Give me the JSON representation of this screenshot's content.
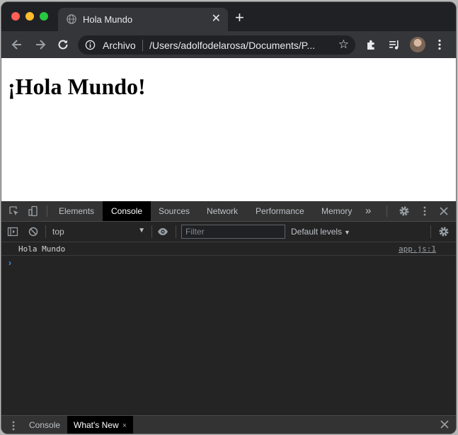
{
  "browser": {
    "tab_title": "Hola Mundo",
    "tab_close": "✕",
    "new_tab": "+",
    "security_label": "Archivo",
    "url": "/Users/adolfodelarosa/Documents/P...",
    "bookmark_star": "☆"
  },
  "page": {
    "heading": "¡Hola Mundo!"
  },
  "devtools": {
    "tabs": [
      "Elements",
      "Console",
      "Sources",
      "Network",
      "Performance",
      "Memory"
    ],
    "active_tab": "Console",
    "more_tabs": "»",
    "context": "top",
    "context_arrow": "▼",
    "filter_placeholder": "Filter",
    "levels_label": "Default levels",
    "levels_arrow": "▼",
    "console": [
      {
        "message": "Hola Mundo",
        "source": "app.js:1"
      }
    ],
    "prompt": "›",
    "drawer": {
      "tabs": [
        "Console",
        "What's New"
      ],
      "active_tab": "What's New",
      "tab_close": "×"
    }
  },
  "colors": {
    "accent": "#4d8ff0",
    "window_bg": "#202124",
    "toolbar_bg": "#35363a"
  }
}
